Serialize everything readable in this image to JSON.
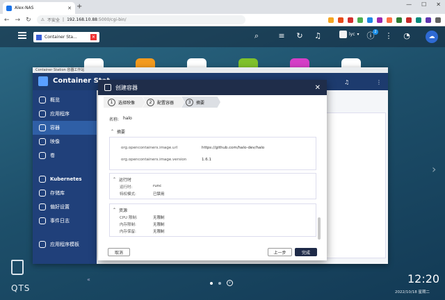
{
  "browser": {
    "tab_title": "Alex-NAS",
    "new_tab": "+",
    "window_controls": [
      "—",
      "☐",
      "✕"
    ],
    "security_label": "不安全",
    "url_host": "192.168.10.88",
    "url_path": ":5000/cgi-bin/",
    "nav": [
      "←",
      "→",
      "↻"
    ],
    "ext_colors": [
      "#f5a623",
      "#e64a19",
      "#d32f2f",
      "#4caf50",
      "#1e88e5",
      "#9c27b0",
      "#ff7043",
      "#2e7d32",
      "#c62828",
      "#00897b",
      "#5e35b1",
      "#616161"
    ]
  },
  "qts": {
    "desktop_tab": "Container Sta...",
    "user_name": "lyc",
    "notification_badge": "2",
    "brand": "QTS",
    "clock": "12:20",
    "date": "2022/10/18 星期二",
    "icon_colors": [
      "#ffffff",
      "#f39a1e",
      "#ffffff",
      "#7fc12b",
      "#d53fc7",
      "#ffffff"
    ]
  },
  "cs": {
    "window_title": "Container Station 容器工作站",
    "app_name": "Container Stat",
    "sidebar": [
      {
        "label": "概览"
      },
      {
        "label": "应用程序"
      },
      {
        "label": "容器"
      },
      {
        "label": "映像"
      },
      {
        "label": "卷"
      },
      {
        "label": "Kubernetes"
      },
      {
        "label": "存储库"
      },
      {
        "label": "偏好设置"
      },
      {
        "label": "事件日志"
      },
      {
        "label": "应用程序模板"
      }
    ],
    "collapse": "«"
  },
  "modal": {
    "title": "创建容器",
    "close": "✕",
    "steps": [
      {
        "num": "1",
        "label": "选择映像"
      },
      {
        "num": "2",
        "label": "配置容器"
      },
      {
        "num": "3",
        "label": "摘要"
      }
    ],
    "name_label": "名称:",
    "name_value": "halo",
    "summary_title": "摘要",
    "labels": [
      {
        "key": "org.opencontainers.image.url",
        "value": "https://github.com/halo-dev/halo"
      },
      {
        "key": "org.opencontainers.image.version",
        "value": "1.6.1"
      }
    ],
    "runtime_title": "运行时",
    "runtime": [
      {
        "key": "运行时:",
        "value": "runc"
      },
      {
        "key": "特权模式:",
        "value": "已禁用"
      }
    ],
    "resources_title": "资源",
    "resources": [
      {
        "key": "CPU 限制:",
        "value": "无限制"
      },
      {
        "key": "内存限制:",
        "value": "无限制"
      },
      {
        "key": "内存保留:",
        "value": "无限制"
      }
    ],
    "cancel": "取消",
    "prev": "上一步",
    "done": "完成"
  }
}
